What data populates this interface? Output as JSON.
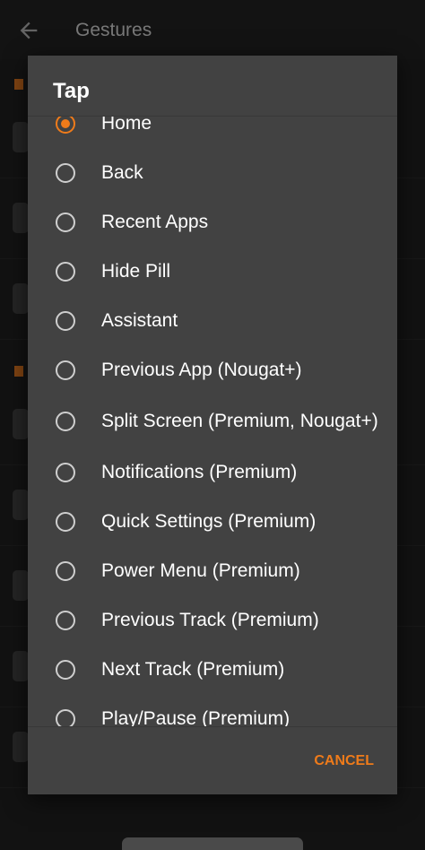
{
  "appbar": {
    "title": "Gestures"
  },
  "dialog": {
    "title": "Tap",
    "selected_index": 0,
    "options": [
      {
        "label": "Home"
      },
      {
        "label": "Back"
      },
      {
        "label": "Recent Apps"
      },
      {
        "label": "Hide Pill"
      },
      {
        "label": "Assistant"
      },
      {
        "label": "Previous App (Nougat+)"
      },
      {
        "label": "Split Screen (Premium, Nougat+)"
      },
      {
        "label": "Notifications (Premium)"
      },
      {
        "label": "Quick Settings (Premium)"
      },
      {
        "label": "Power Menu (Premium)"
      },
      {
        "label": "Previous Track (Premium)"
      },
      {
        "label": "Next Track (Premium)"
      },
      {
        "label": "Play/Pause (Premium)"
      }
    ],
    "cancel_label": "CANCEL"
  },
  "colors": {
    "accent": "#ef7b1a",
    "dialog_background": "#424242",
    "screen_background": "#1c1c1c"
  },
  "icons": {
    "back": "arrow-back-icon",
    "gesture": "gesture-icon"
  }
}
